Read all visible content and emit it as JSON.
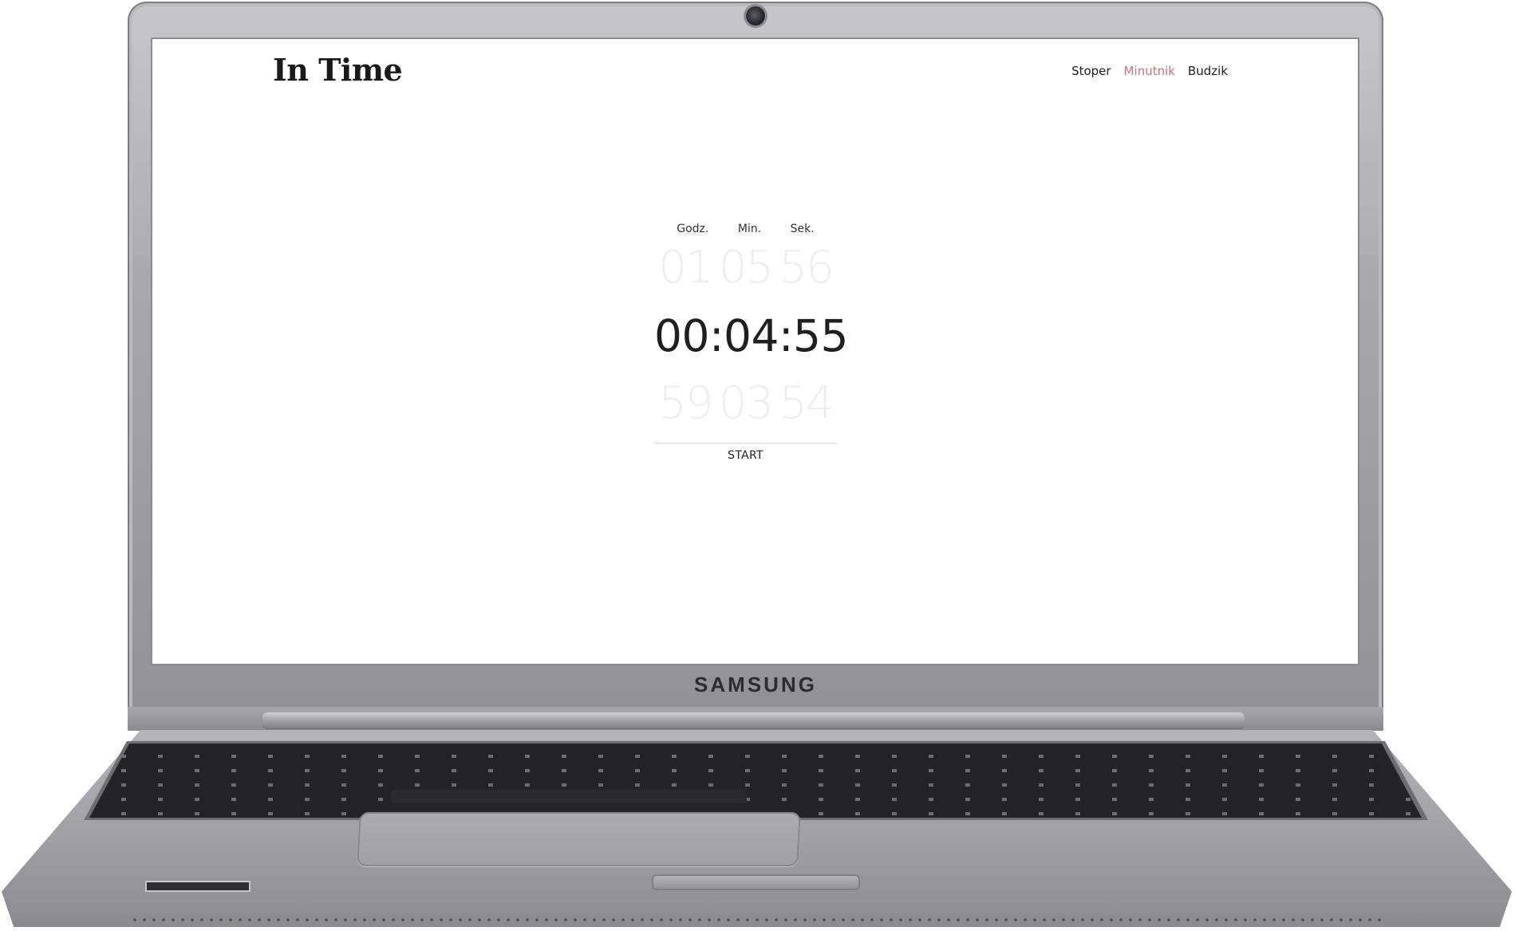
{
  "site": {
    "logo": "In Time",
    "nav": [
      {
        "label": "Stoper",
        "active": false
      },
      {
        "label": "Minutnik",
        "active": true
      },
      {
        "label": "Budzik",
        "active": false
      }
    ],
    "accent_color": "#c4737f"
  },
  "timer": {
    "labels": [
      "Godz.",
      "Min.",
      "Sek."
    ],
    "above": [
      "01",
      "05",
      "56"
    ],
    "current": "00:04:55",
    "below": [
      "59",
      "03",
      "54"
    ],
    "start_label": "START"
  },
  "device": {
    "brand": "SAMSUNG"
  }
}
